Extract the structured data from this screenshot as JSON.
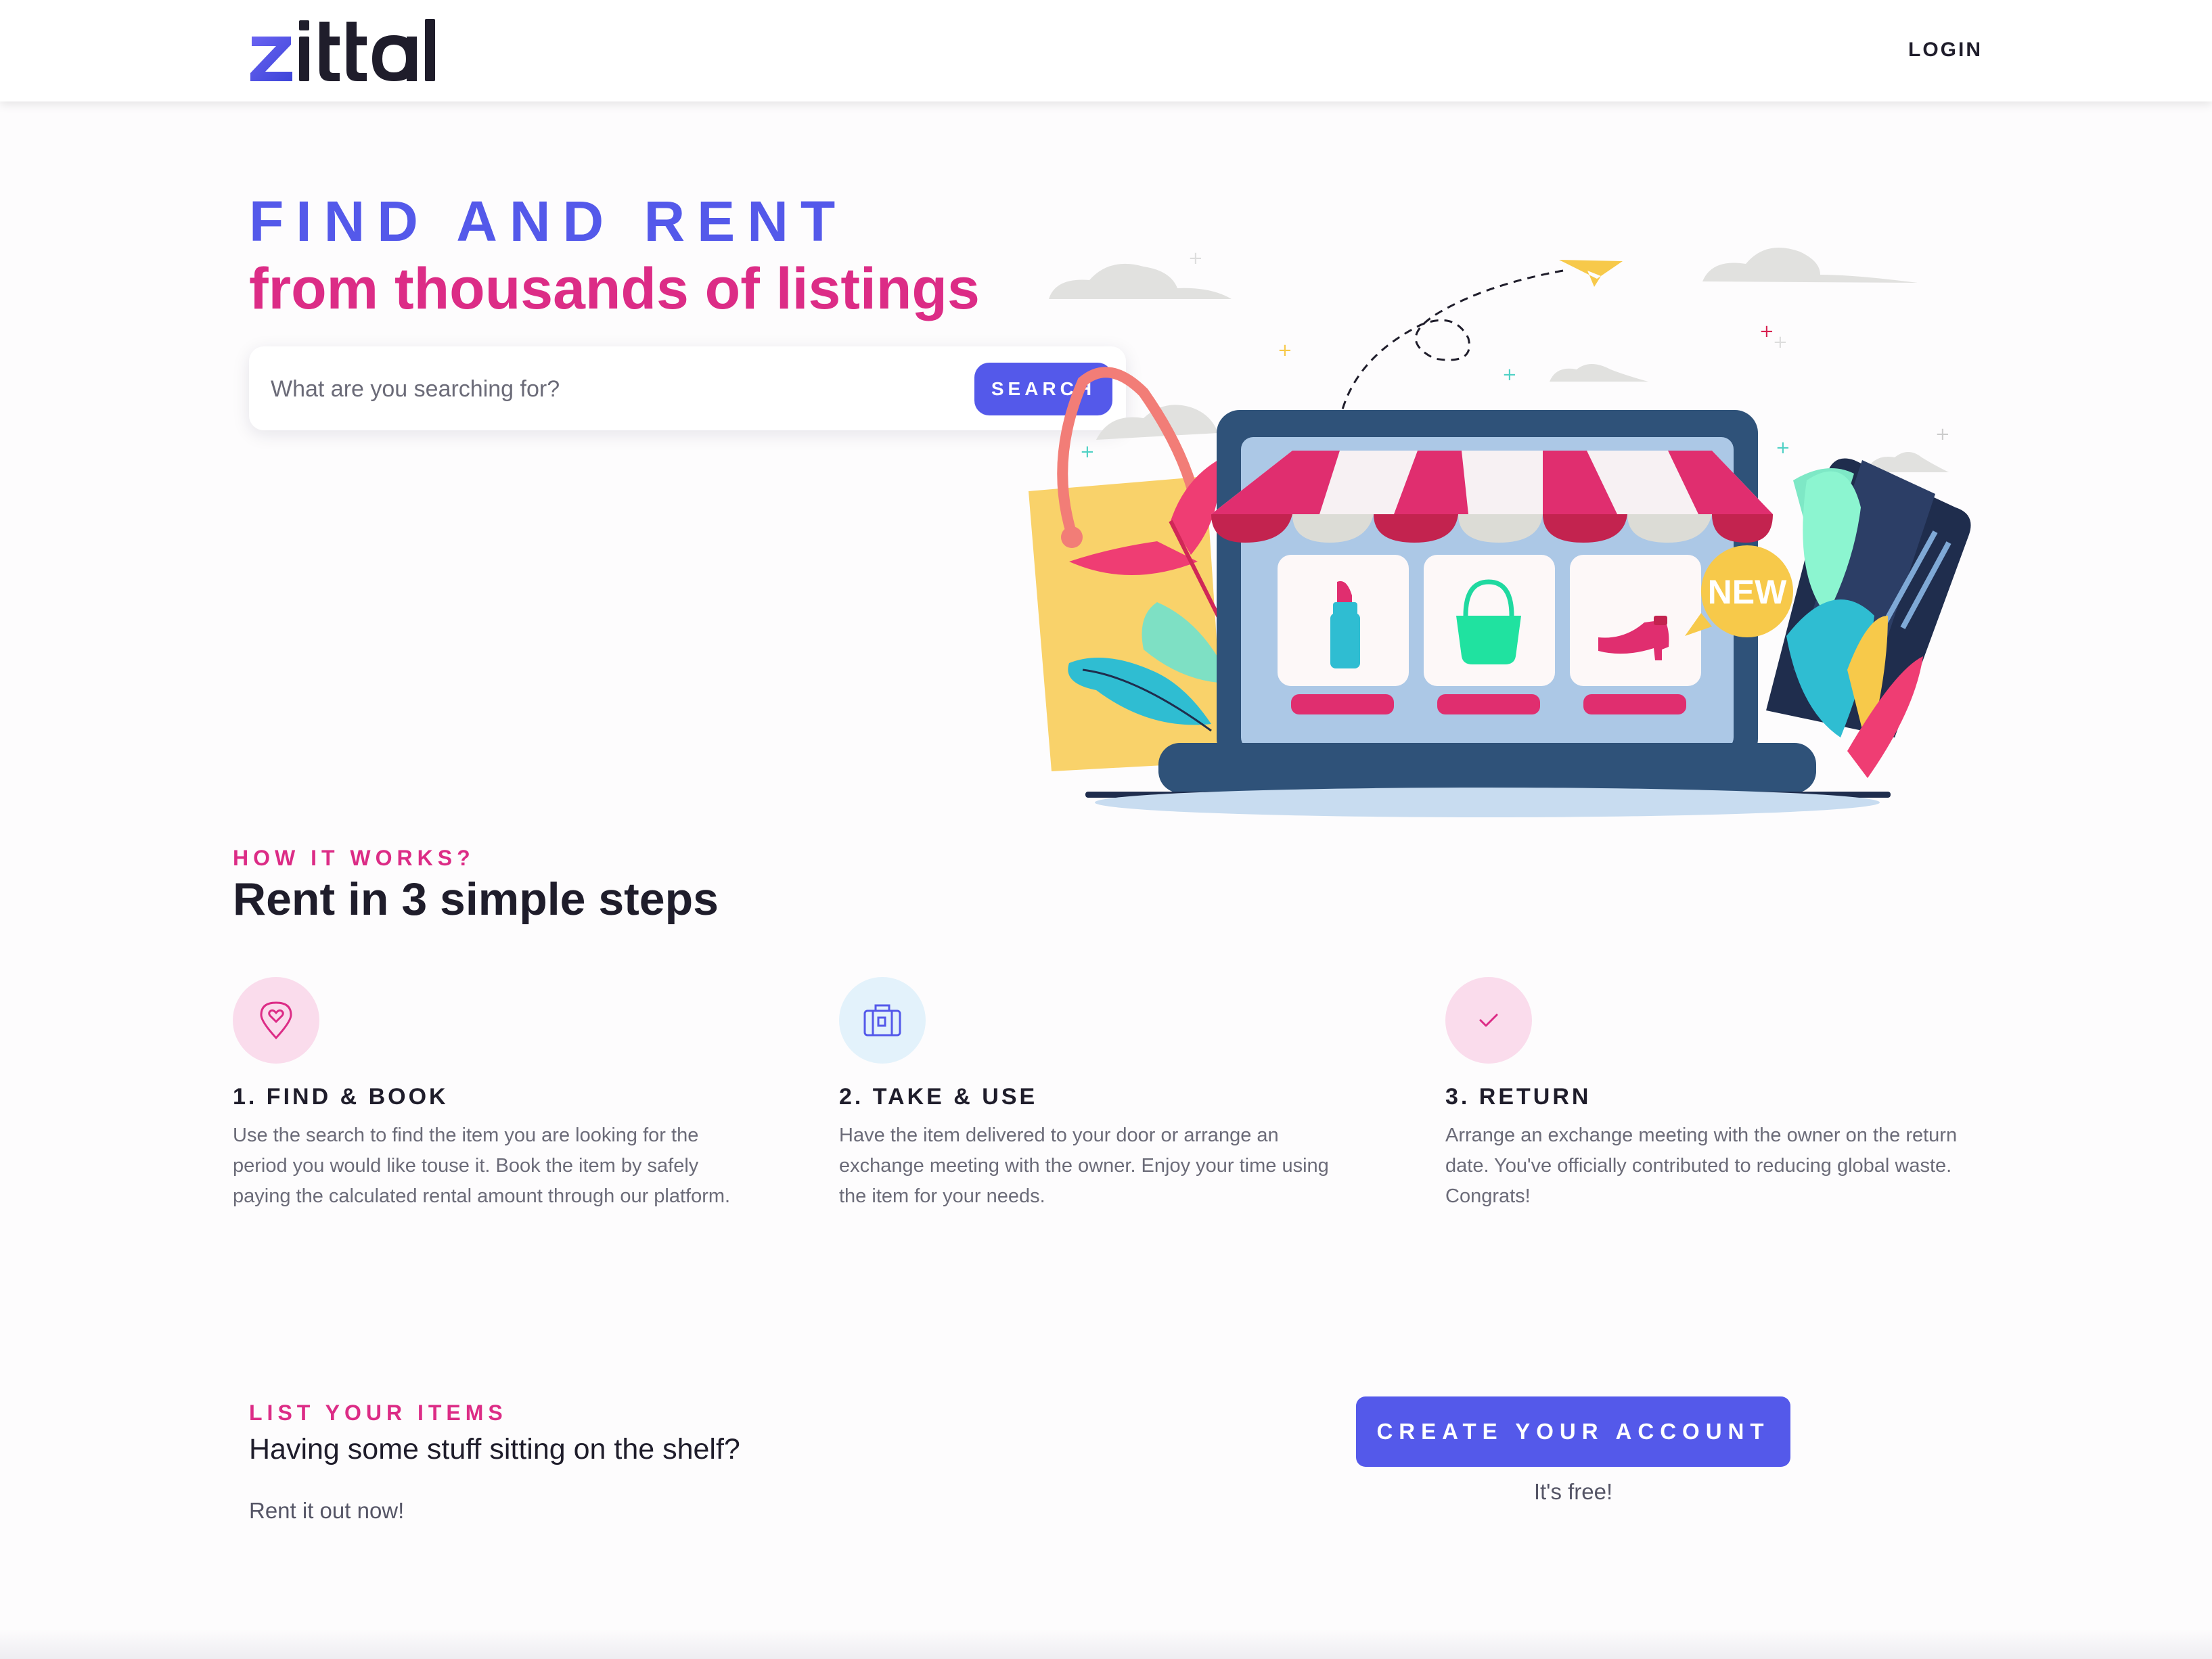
{
  "header": {
    "logo_text": "zittal",
    "login_label": "LOGIN"
  },
  "hero": {
    "title": "FIND AND RENT",
    "subtitle": "from thousands of listings",
    "search_placeholder": "What are you searching for?",
    "search_button": "SEARCH",
    "illustration_badge": "NEW"
  },
  "how_it_works": {
    "eyebrow": "HOW IT WORKS?",
    "title": "Rent in 3 simple steps",
    "steps": [
      {
        "icon": "location-heart-icon",
        "title": "1. FIND & BOOK",
        "text": "Use the search to find the item you are looking for the period you would like touse it. Book the item by safely paying the calculated rental amount through our platform."
      },
      {
        "icon": "suitcase-icon",
        "title": "2. TAKE & USE",
        "text": "Have the item delivered to your door or arrange an exchange meeting with the owner. Enjoy your time using the item for your needs."
      },
      {
        "icon": "checkmark-icon",
        "title": "3. RETURN",
        "text": "Arrange an exchange meeting with the owner on the return date. You've officially contributed to reducing global waste. Congrats!"
      }
    ]
  },
  "list_items": {
    "eyebrow": "LIST YOUR ITEMS",
    "question": "Having some stuff sitting on the shelf?",
    "prompt": "Rent it out now!",
    "cta_label": "CREATE YOUR ACCOUNT",
    "cta_note": "It's free!"
  },
  "colors": {
    "primary": "#5459ea",
    "accent": "#dc2c86",
    "text": "#1f1d2b",
    "muted": "#6b6b78",
    "step_icon_bg_pink": "#fadcec",
    "step_icon_bg_blue": "#e3f2fb"
  }
}
